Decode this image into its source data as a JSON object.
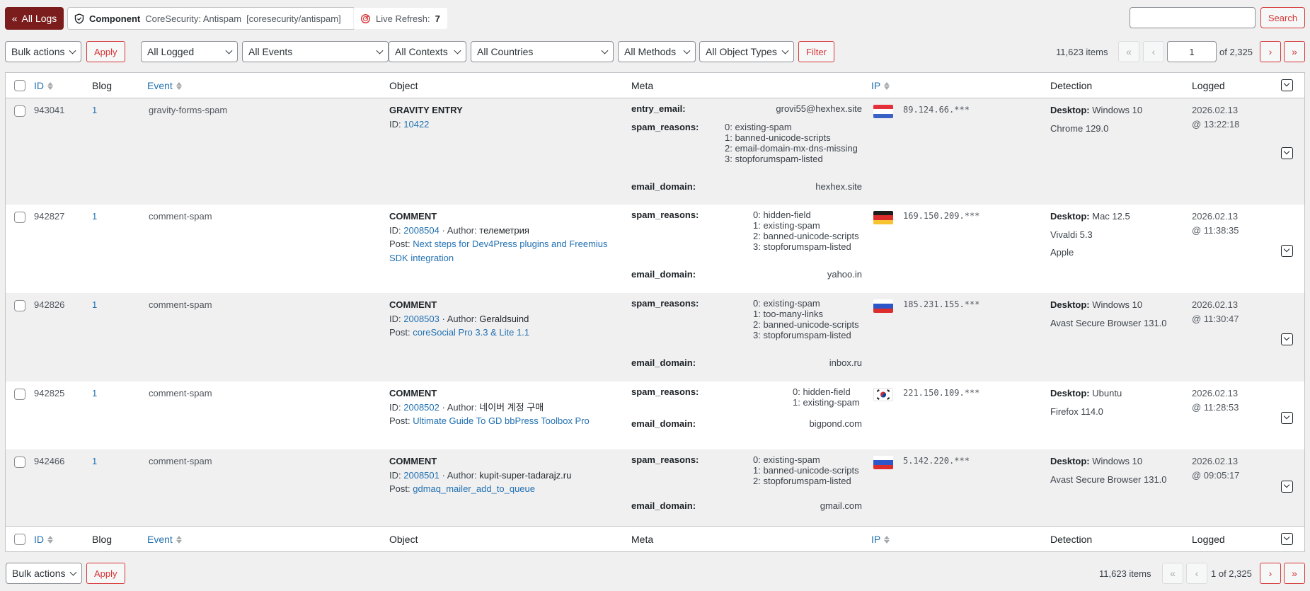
{
  "topbar": {
    "all_logs_label": "All Logs",
    "component_label": "Component",
    "component_name": "CoreSecurity: Antispam",
    "component_slug": "[coresecurity/antispam]",
    "live_refresh_label": "Live Refresh:",
    "live_refresh_value": "7",
    "search_placeholder": "",
    "search_label": "Search"
  },
  "filters": {
    "bulk_actions": "Bulk actions",
    "apply": "Apply",
    "logged": "All Logged",
    "events": "All Events",
    "contexts": "All Contexts",
    "countries": "All Countries",
    "methods": "All Methods",
    "object_types": "All Object Types",
    "filter": "Filter"
  },
  "pagination": {
    "items": "11,623 items",
    "first": "«",
    "prev": "‹",
    "next": "›",
    "last": "»",
    "current_page": "1",
    "of_pages": "of 2,325",
    "bottom_label": "1 of 2,325"
  },
  "columns": {
    "id": "ID",
    "blog": "Blog",
    "event": "Event",
    "object": "Object",
    "meta": "Meta",
    "ip": "IP",
    "detection": "Detection",
    "logged": "Logged"
  },
  "rows": [
    {
      "id": "943041",
      "blog": "1",
      "event": "gravity-forms-spam",
      "object_type": "GRAVITY ENTRY",
      "object_id_label": "ID:",
      "object_id": "10422",
      "meta": {
        "entry_email_key": "entry_email:",
        "entry_email": "grovi55@hexhex.site",
        "spam_reasons_key": "spam_reasons:",
        "spam_reasons": [
          "0: existing-spam",
          "1: banned-unicode-scripts",
          "2: email-domain-mx-dns-missing",
          "3: stopforumspam-listed"
        ],
        "email_domain_key": "email_domain:",
        "email_domain": "hexhex.site"
      },
      "country": "NL",
      "ip": "89.124.66.***",
      "det_label": "Desktop:",
      "os": "Windows 10",
      "browser": "Chrome 129.0",
      "date": "2026.02.13",
      "time": "@ 13:22:18"
    },
    {
      "id": "942827",
      "blog": "1",
      "event": "comment-spam",
      "object_type": "COMMENT",
      "object_id_label": "ID:",
      "object_id": "2008504",
      "author_label": "· Author:",
      "author": "телеметрия",
      "post_label": "Post:",
      "post": "Next steps for Dev4Press plugins and Freemius SDK integration",
      "meta": {
        "spam_reasons_key": "spam_reasons:",
        "spam_reasons": [
          "0: hidden-field",
          "1: existing-spam",
          "2: banned-unicode-scripts",
          "3: stopforumspam-listed"
        ],
        "email_domain_key": "email_domain:",
        "email_domain": "yahoo.in"
      },
      "country": "DE",
      "ip": "169.150.209.***",
      "det_label": "Desktop:",
      "os": "Mac 12.5",
      "browser": "Vivaldi 5.3",
      "device": "Apple",
      "date": "2026.02.13",
      "time": "@ 11:38:35"
    },
    {
      "id": "942826",
      "blog": "1",
      "event": "comment-spam",
      "object_type": "COMMENT",
      "object_id_label": "ID:",
      "object_id": "2008503",
      "author_label": "· Author:",
      "author": "Geraldsuind",
      "post_label": "Post:",
      "post": "coreSocial Pro 3.3 & Lite 1.1",
      "meta": {
        "spam_reasons_key": "spam_reasons:",
        "spam_reasons": [
          "0: existing-spam",
          "1: too-many-links",
          "2: banned-unicode-scripts",
          "3: stopforumspam-listed"
        ],
        "email_domain_key": "email_domain:",
        "email_domain": "inbox.ru"
      },
      "country": "RU",
      "ip": "185.231.155.***",
      "det_label": "Desktop:",
      "os": "Windows 10",
      "browser": "Avast Secure Browser 131.0",
      "date": "2026.02.13",
      "time": "@ 11:30:47"
    },
    {
      "id": "942825",
      "blog": "1",
      "event": "comment-spam",
      "object_type": "COMMENT",
      "object_id_label": "ID:",
      "object_id": "2008502",
      "author_label": "· Author:",
      "author": "네이버 계정 구매",
      "post_label": "Post:",
      "post": "Ultimate Guide To GD bbPress Toolbox Pro",
      "meta": {
        "spam_reasons_key": "spam_reasons:",
        "spam_reasons": [
          "0: hidden-field",
          "1: existing-spam"
        ],
        "email_domain_key": "email_domain:",
        "email_domain": "bigpond.com"
      },
      "country": "KR",
      "ip": "221.150.109.***",
      "det_label": "Desktop:",
      "os": "Ubuntu",
      "browser": "Firefox 114.0",
      "date": "2026.02.13",
      "time": "@ 11:28:53"
    },
    {
      "id": "942466",
      "blog": "1",
      "event": "comment-spam",
      "object_type": "COMMENT",
      "object_id_label": "ID:",
      "object_id": "2008501",
      "author_label": "· Author:",
      "author": "kupit-super-tadarajz.ru",
      "post_label": "Post:",
      "post": "gdmaq_mailer_add_to_queue",
      "meta": {
        "spam_reasons_key": "spam_reasons:",
        "spam_reasons": [
          "0: existing-spam",
          "1: banned-unicode-scripts",
          "2: stopforumspam-listed"
        ],
        "email_domain_key": "email_domain:",
        "email_domain": "gmail.com"
      },
      "country": "RU",
      "ip": "5.142.220.***",
      "det_label": "Desktop:",
      "os": "Windows 10",
      "browser": "Avast Secure Browser 131.0",
      "date": "2026.02.13",
      "time": "@ 09:05:17"
    }
  ],
  "colors": {
    "accent": "#7b1d1d",
    "danger": "#d63638",
    "link": "#2271b1"
  }
}
